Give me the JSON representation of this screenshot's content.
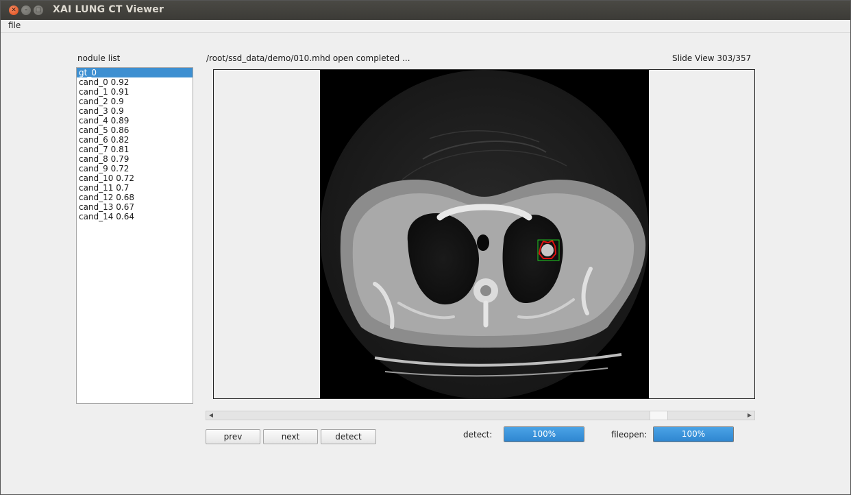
{
  "window": {
    "title": "XAI LUNG CT Viewer"
  },
  "menu": {
    "file_label": "file"
  },
  "nodule_list": {
    "title": "nodule list",
    "selected_index": 0,
    "items": [
      "gt_0",
      "cand_0 0.92",
      "cand_1 0.91",
      "cand_2 0.9",
      "cand_3 0.9",
      "cand_4 0.89",
      "cand_5 0.86",
      "cand_6 0.82",
      "cand_7 0.81",
      "cand_8 0.79",
      "cand_9 0.72",
      "cand_10 0.72",
      "cand_11 0.7",
      "cand_12 0.68",
      "cand_13 0.67",
      "cand_14 0.64"
    ]
  },
  "status": {
    "message": "/root/ssd_data/demo/010.mhd open completed ..."
  },
  "slide": {
    "label": "Slide View 303/357",
    "current": 303,
    "total": 357
  },
  "buttons": {
    "prev": "prev",
    "next": "next",
    "detect": "detect"
  },
  "progress": {
    "detect_label": "detect:",
    "detect_value": 100,
    "detect_text": "100%",
    "fileopen_label": "fileopen:",
    "fileopen_value": 100,
    "fileopen_text": "100%"
  },
  "colors": {
    "selection": "#3d8fd1",
    "progress": "#3a93db",
    "nodule_box": "#22cc22",
    "nodule_contour": "#e01010"
  },
  "icons": {
    "close": "close-icon",
    "minimize": "minimize-icon",
    "maximize": "maximize-icon",
    "scroll_left": "arrow-left-icon",
    "scroll_right": "arrow-right-icon"
  }
}
